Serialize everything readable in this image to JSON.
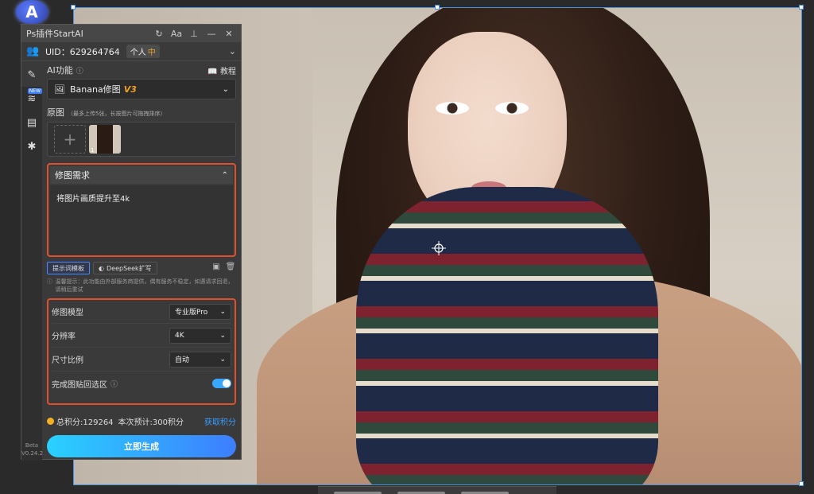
{
  "app": {
    "title": "Ps插件StartAI",
    "logo_letter": "A"
  },
  "titlebar": {
    "icons": [
      "refresh-icon",
      "font-size-icon",
      "pin-icon",
      "minimize-icon",
      "close-icon"
    ],
    "glyphs": [
      "↻",
      "Aa",
      "⊥",
      "—",
      "✕"
    ]
  },
  "account": {
    "uid_label": "UID：629264764",
    "plan_label": "个人",
    "plan_badge": "中"
  },
  "sidebar": {
    "items": [
      {
        "name": "edit-icon",
        "glyph": "✎"
      },
      {
        "name": "layers-icon",
        "glyph": "≋",
        "badge": "NEW"
      },
      {
        "name": "clipboard-icon",
        "glyph": "▤"
      },
      {
        "name": "gear-icon",
        "glyph": "✱"
      }
    ],
    "version": "Beta\nV0.24.2"
  },
  "ai_function": {
    "label": "AI功能",
    "tutorial": "教程",
    "model_select": "Banana修图",
    "model_tag": "V3"
  },
  "original": {
    "label": "原图",
    "hint": "（最多上传5张，长按图片可拖拽排序）",
    "thumb_index": "1"
  },
  "request": {
    "label": "修图需求",
    "text": "将图片画质提升至4k"
  },
  "tools": {
    "template_btn": "提示词模板",
    "deepseek_btn": "DeepSeek扩写"
  },
  "warning": {
    "text": "温馨提示：此功能由外部服务商提供，偶有服务不稳定，如遇请求回退，请稍后重试"
  },
  "settings": {
    "rows": [
      {
        "label": "修图模型",
        "value": "专业版Pro"
      },
      {
        "label": "分辨率",
        "value": "4K"
      },
      {
        "label": "尺寸比例",
        "value": "自动"
      }
    ],
    "toggle_label": "完成图贴回选区",
    "toggle_on": true
  },
  "points": {
    "total": "总积分:129264",
    "estimate": "本次预计:300积分",
    "get_points": "获取积分"
  },
  "generate_button": "立即生成",
  "colors": {
    "highlight_border": "#e05030",
    "accent_blue": "#3d7eff",
    "accent_cyan": "#29d1ff",
    "gold": "#f0a020"
  }
}
